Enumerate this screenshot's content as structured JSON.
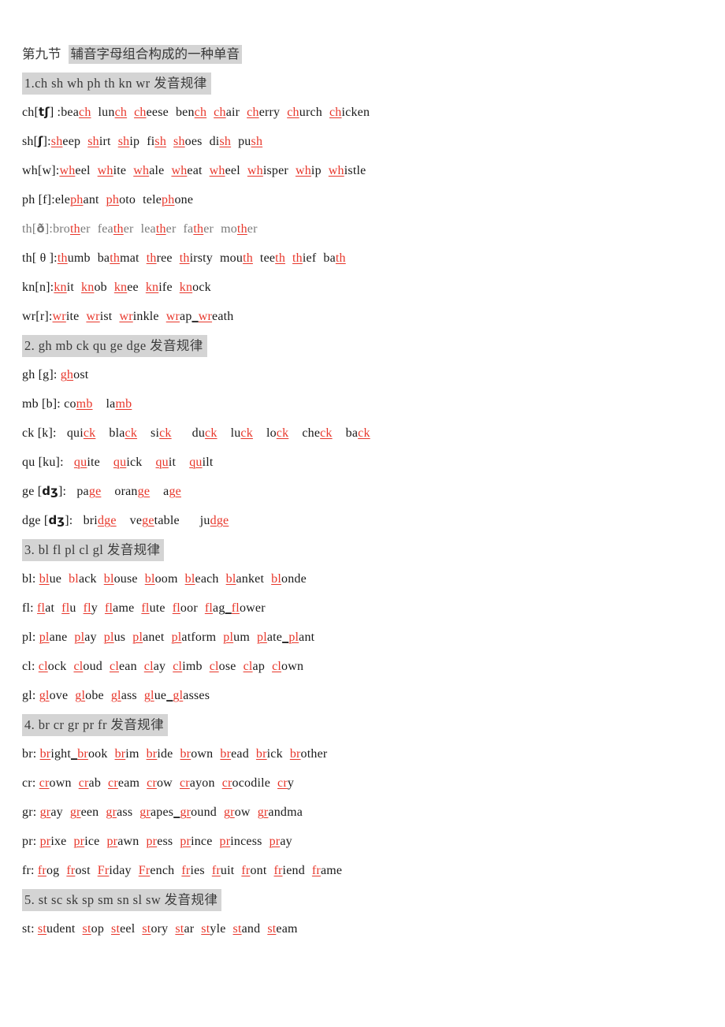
{
  "document": {
    "title_prefix": "第九节",
    "title_highlight": "辅音字母组合构成的一种单音",
    "highlight_color": "#d4d4d4",
    "accent_color": "#e8372b",
    "text_color": "#1a1a1a"
  },
  "sections": [
    {
      "heading": "1.ch sh wh ph th kn wr  发音规律",
      "number": "1",
      "lines": [
        {
          "label": "ch[tʃ] :",
          "ipa": "tʃ",
          "faint": false,
          "words": [
            "beach",
            "lunch",
            "cheese",
            "bench",
            "chair",
            "cherry",
            "church",
            "chicken"
          ],
          "raw": "ch[tʃ] :beach lunch cheese bench chair cherry church chicken"
        },
        {
          "label": "sh[ʃ]:",
          "ipa": "ʃ",
          "faint": false,
          "words": [
            "sheep",
            "shirt",
            "ship",
            "fish",
            "shoes",
            "dish",
            "push"
          ],
          "raw": "sh[ʃ]:sheep shirt ship fish shoes dish push"
        },
        {
          "label": "wh[w]:",
          "ipa": "w",
          "faint": false,
          "words": [
            "wheel",
            "white",
            "whale",
            "wheat",
            "wheel",
            "whisper",
            "whip",
            "whistle"
          ],
          "raw": "wh[w]:wheel white whale wheat wheel whisper whip whistle"
        },
        {
          "label": "ph [f]:",
          "ipa": "f",
          "faint": false,
          "words": [
            "elephant",
            "photo",
            "telephone"
          ],
          "raw": "ph [f]:elephant photo telephone"
        },
        {
          "label": "th[ð]:",
          "ipa": "ð",
          "faint": true,
          "words": [
            "brother",
            "feather",
            "leather",
            "father",
            "mother"
          ],
          "raw": "th[ð]:brother feather leather father mother"
        },
        {
          "label": "th[ θ ]:",
          "ipa": "θ",
          "faint": false,
          "words": [
            "thumb",
            "bathmat",
            "three",
            "thirsty",
            "mouth",
            "teeth",
            "thief",
            "bath"
          ],
          "raw": "th[ θ ]:thumb bathmat three thirsty mouth teeth thief bath"
        },
        {
          "label": "kn[n]:",
          "ipa": "n",
          "faint": false,
          "words": [
            "knit",
            "knob",
            "knee",
            "knife",
            "knock"
          ],
          "raw": "kn[n]:knit knob knee knife knock"
        },
        {
          "label": "wr[r]:",
          "ipa": "r",
          "faint": false,
          "words": [
            "write",
            "wrist",
            "wrinkle",
            "wrap",
            "wreath"
          ],
          "raw": "wr[r]:write wrist wrinkle wrap_wreath"
        }
      ]
    },
    {
      "heading": "2. gh mb ck qu ge dge  发音规律",
      "number": "2",
      "lines": [
        {
          "label": "gh [g]: ",
          "ipa": "g",
          "faint": false,
          "words": [
            "ghost"
          ],
          "raw": "gh [g]: ghost"
        },
        {
          "label": "mb [b]: ",
          "ipa": "b",
          "faint": false,
          "words": [
            "comb",
            "lamb"
          ],
          "raw": "mb [b]: comb  lamb"
        },
        {
          "label": "ck [k]:  ",
          "ipa": "k",
          "faint": false,
          "words": [
            "quick",
            "black",
            "sick",
            "duck",
            "luck",
            "lock",
            "check",
            "back"
          ],
          "raw": "ck [k]:  quick  black  sick   duck  luck  lock  check  back"
        },
        {
          "label": "qu [ku]:  ",
          "ipa": "ku",
          "faint": false,
          "words": [
            "quite",
            "quick",
            "quit",
            "quilt"
          ],
          "raw": "qu [ku]:  quite  quick  quit  quilt"
        },
        {
          "label": "ge [dʒ]:  ",
          "ipa": "dʒ",
          "faint": false,
          "words": [
            "page",
            "orange",
            "age"
          ],
          "raw": "ge [dʒ]:  page  orange  age"
        },
        {
          "label": "dge [dʒ]:  ",
          "ipa": "dʒ",
          "faint": false,
          "words": [
            "bridge",
            "vegetable",
            "judge"
          ],
          "raw": "dge [dʒ]:  bridge  vegetable   judge"
        }
      ]
    },
    {
      "heading": "3. bl fl pl cl gl  发音规律",
      "number": "3",
      "lines": [
        {
          "label": "bl: ",
          "faint": false,
          "words": [
            "blue",
            "black",
            "blouse",
            "bloom",
            "bleach",
            "blanket",
            "blonde"
          ],
          "raw": "bl: blue black blouse bloom bleach blanket blonde"
        },
        {
          "label": "fl: ",
          "faint": false,
          "words": [
            "flat",
            "flu",
            "fly",
            "flame",
            "flute",
            "floor",
            "flag",
            "flower"
          ],
          "raw": "fl: flat flu fly flame flute floor flag_flower"
        },
        {
          "label": "pl: ",
          "faint": false,
          "words": [
            "plane",
            "play",
            "plus",
            "planet",
            "platform",
            "plum",
            "plate",
            "plant"
          ],
          "raw": "pl: plane play plus planet platform plum plate_plant"
        },
        {
          "label": "cl: ",
          "faint": false,
          "words": [
            "clock",
            "cloud",
            "clean",
            "clay",
            "climb",
            "close",
            "clap",
            "clown"
          ],
          "raw": "cl: clock cloud clean clay climb close clap clown"
        },
        {
          "label": "gl: ",
          "faint": false,
          "words": [
            "glove",
            "globe",
            "glass",
            "glue",
            "glasses"
          ],
          "raw": "gl: glove globe glass glue_glasses"
        }
      ]
    },
    {
      "heading": "4. br cr gr pr fr  发音规律",
      "number": "4",
      "lines": [
        {
          "label": "br: ",
          "faint": false,
          "words": [
            "bright",
            "brook",
            "brim",
            "bride",
            "brown",
            "bread",
            "brick",
            "brother"
          ],
          "raw": "br: bright_brook brim bride brown bread brick brother"
        },
        {
          "label": "cr: ",
          "faint": false,
          "words": [
            "crown",
            "crab",
            "cream",
            "crow",
            "crayon",
            "crocodile",
            "cry"
          ],
          "raw": "cr: crown crab cream crow crayon crocodile cry"
        },
        {
          "label": "gr: ",
          "faint": false,
          "words": [
            "gray",
            "green",
            "grass",
            "grapes",
            "ground",
            "grow",
            "grandma"
          ],
          "raw": "gr: gray green grass grapes_ground grow grandma"
        },
        {
          "label": "pr: ",
          "faint": false,
          "words": [
            "prixe",
            "price",
            "prawn",
            "press",
            "prince",
            "princess",
            "pray"
          ],
          "raw": "pr: prixe price prawn press prince princess pray"
        },
        {
          "label": "fr: ",
          "faint": false,
          "words": [
            "frog",
            "frost",
            "Friday",
            "French",
            "fries",
            "fruit",
            "front",
            "friend",
            "frame"
          ],
          "raw": "fr: frog frost Friday French fries fruit front friend frame"
        }
      ]
    },
    {
      "heading": "5. st sc sk sp sm sn sl sw  发音规律",
      "number": "5",
      "lines": [
        {
          "label": "st: ",
          "faint": false,
          "words": [
            "student",
            "stop",
            "steel",
            "story",
            "star",
            "style",
            "stand",
            "steam"
          ],
          "raw": "st: student stop steel story star style stand steam"
        }
      ]
    }
  ]
}
